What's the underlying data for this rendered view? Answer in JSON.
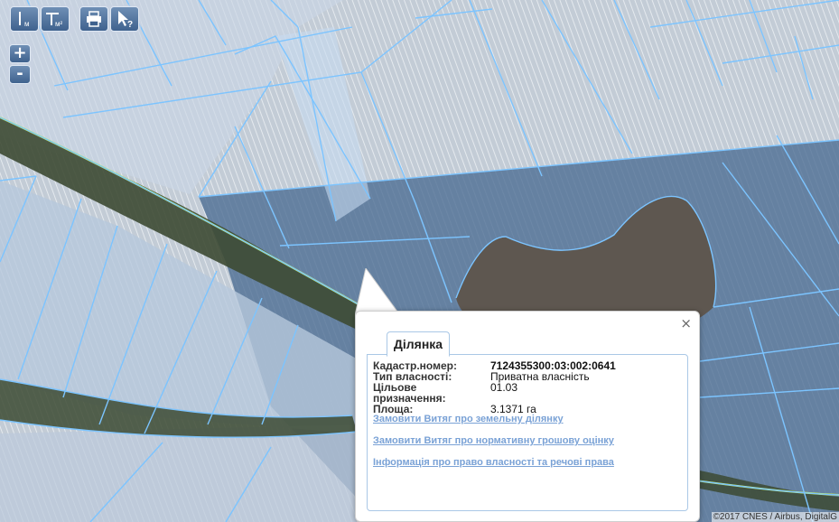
{
  "toolbar": {
    "groups": [
      {
        "name": "measure-tools",
        "buttons": [
          {
            "name": "measure-length-button",
            "icon": "measure-length-icon",
            "unit": "м"
          },
          {
            "name": "measure-area-button",
            "icon": "measure-area-icon",
            "unit": "м²"
          }
        ]
      },
      {
        "name": "misc-tools",
        "buttons": [
          {
            "name": "print-button",
            "icon": "printer-icon"
          },
          {
            "name": "identify-button",
            "icon": "cursor-help-icon"
          }
        ]
      }
    ]
  },
  "zoom": {
    "in_label": "+",
    "out_label": "-"
  },
  "popup": {
    "close_label": "×",
    "tab_label": "Ділянка",
    "rows": [
      {
        "key": "Кадастр.номер:",
        "value": "7124355300:03:002:0641"
      },
      {
        "key": "Тип власності:",
        "value": "Приватна власність"
      },
      {
        "key": "Цільове призначення:",
        "value": "01.03"
      },
      {
        "key": "Площа:",
        "value": "3.1371 га"
      }
    ],
    "links": [
      "Замовити Витяг про земельну ділянку",
      "Замовити Витяг про нормативну грошову оцінку",
      "Інформація про право власності та речові права"
    ]
  },
  "attribution": "©2017 CNES / Airbus, DigitalG",
  "colors": {
    "parcel_stroke": "#7cc4ff",
    "road_line": "#d7ff3a",
    "link": "#7aa2d6",
    "toolbar": "#3f628e"
  }
}
